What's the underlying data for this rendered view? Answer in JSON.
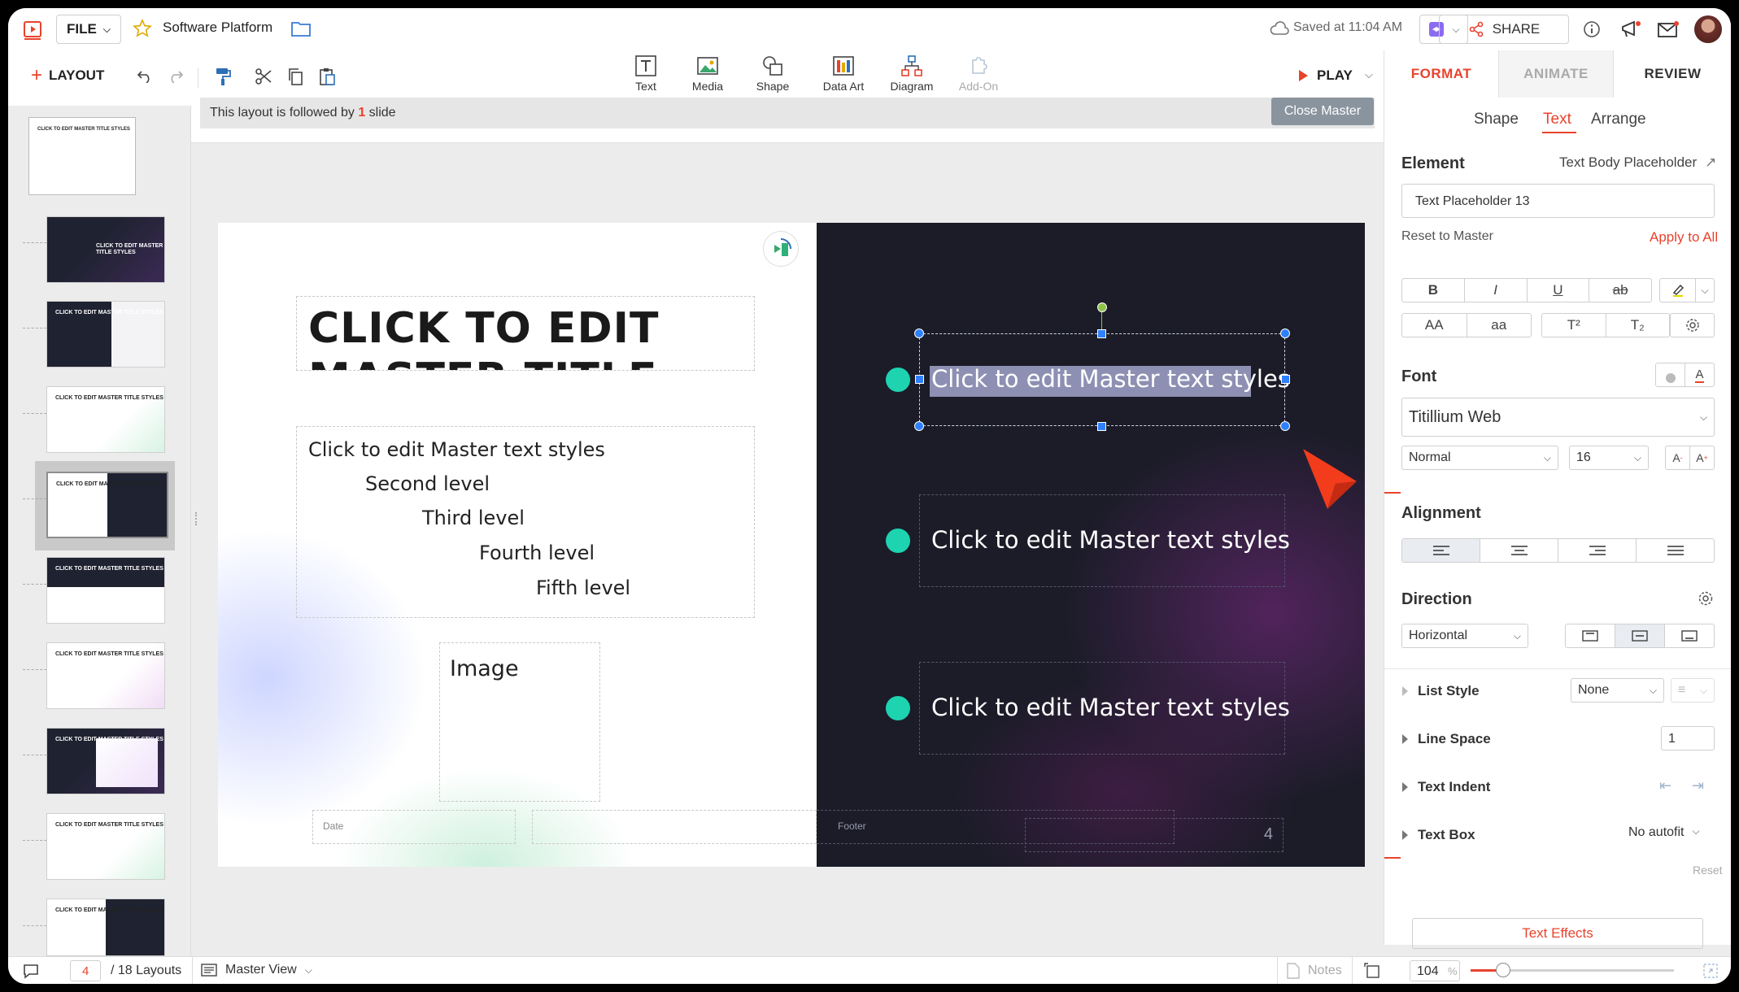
{
  "header": {
    "file_label": "FILE",
    "doc_title": "Software Platform",
    "saved_status": "Saved at 11:04 AM",
    "share_label": "SHARE"
  },
  "toolbar": {
    "layout_label": "LAYOUT",
    "play_label": "PLAY",
    "tools": [
      {
        "label": "Text",
        "icon": "text-icon"
      },
      {
        "label": "Media",
        "icon": "media-icon"
      },
      {
        "label": "Shape",
        "icon": "shape-icon"
      },
      {
        "label": "Data Art",
        "icon": "data-art-icon"
      },
      {
        "label": "Diagram",
        "icon": "diagram-icon"
      },
      {
        "label": "Add-On",
        "icon": "add-on-icon"
      }
    ]
  },
  "infobar": {
    "prefix": "This layout is followed by",
    "count": "1",
    "suffix": "slide",
    "close_master": "Close Master"
  },
  "slide": {
    "title": "CLICK TO EDIT MASTER TITLE",
    "levels": [
      "Click to edit Master text styles",
      "Second level",
      "Third level",
      "Fourth level",
      "Fifth level"
    ],
    "image_label": "Image",
    "items": [
      "Click to edit Master text styles",
      "Click to edit Master text styles",
      "Click to edit Master text styles"
    ],
    "date_label": "Date",
    "footer_label": "Footer",
    "page_number": "4"
  },
  "thumbnails": [
    {
      "title": "CLICK TO EDIT MASTER TITLE STYLES",
      "dark": false
    },
    {
      "title": "CLICK TO EDIT MASTER TITLE STYLES",
      "dark": true
    },
    {
      "title": "CLICK TO EDIT MASTER TITLE STYLES",
      "dark": true
    },
    {
      "title": "CLICK TO EDIT MASTER TITLE STYLES",
      "dark": false
    },
    {
      "title": "CLICK TO EDIT MASTER TITLE STYLES",
      "dark": false
    },
    {
      "title": "CLICK TO EDIT MASTER TITLE STYLES",
      "dark": false
    },
    {
      "title": "CLICK TO EDIT MASTER TITLE STYLES",
      "dark": false
    },
    {
      "title": "CLICK TO EDIT MASTER TITLE STYLES",
      "dark": true
    },
    {
      "title": "CLICK TO EDIT MASTER TITLE STYLES",
      "dark": false
    },
    {
      "title": "CLICK TO EDIT MASTER TITLE STYLES",
      "dark": false
    }
  ],
  "panel": {
    "tabs": [
      "FORMAT",
      "ANIMATE",
      "REVIEW"
    ],
    "subtabs": [
      "Shape",
      "Text",
      "Arrange"
    ],
    "element_label": "Element",
    "element_type": "Text Body Placeholder",
    "element_name": "Text Placeholder 13",
    "reset_master": "Reset to Master",
    "apply_all": "Apply to All",
    "font_label": "Font",
    "font_family": "Titillium Web",
    "font_style": "Normal",
    "font_size": "16",
    "alignment_label": "Alignment",
    "direction_label": "Direction",
    "direction_value": "Horizontal",
    "list_style_label": "List Style",
    "list_style_value": "None",
    "line_space_label": "Line Space",
    "line_space_value": "1",
    "text_indent_label": "Text Indent",
    "text_box_label": "Text Box",
    "text_box_value": "No autofit",
    "reset_label": "Reset",
    "text_effects": "Text Effects",
    "case_upper": "AA",
    "case_lower": "aa",
    "superscript": "T²",
    "subscript": "T₂",
    "bold": "B",
    "italic": "I",
    "underline": "U",
    "strike": "ab"
  },
  "statusbar": {
    "page_current": "4",
    "page_total": "/ 18 Layouts",
    "view_mode": "Master View",
    "notes_label": "Notes",
    "zoom_value": "104",
    "zoom_unit": "%",
    "zoom_level": 0.16
  },
  "colors": {
    "accent": "#e8432d",
    "teal": "#1dd3b0",
    "selection": "#2f80ff"
  }
}
